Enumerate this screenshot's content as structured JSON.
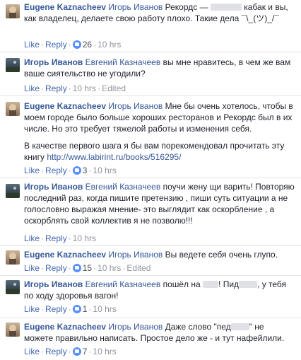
{
  "comments": [
    {
      "author": "Eugene Kaznacheev",
      "mention": "Игорь Иванов",
      "text_a": "Рекордс —",
      "text_b": "кабак и вы, как владелец, делаете свою работу плохо. Такие дела ¯\\_(ツ)_/¯",
      "like": "Like",
      "reply": "Reply",
      "likes": "26",
      "time": "10 hrs",
      "edited": ""
    },
    {
      "author": "Игорь Иванов",
      "mention": "Евгений Казначеев",
      "text": "вы мне нравитесь, в чем же вам ваше сиятельство не угодили?",
      "like": "Like",
      "reply": "Reply",
      "likes": "",
      "time": "10 hrs",
      "edited": "Edited"
    },
    {
      "author": "Eugene Kaznacheev",
      "mention": "Игорь Иванов",
      "text": "Мне бы очень хотелось, чтобы в моем городе было больше хороших ресторанов и Рекордс был в их числе. Но это требует тяжелой работы и изменения себя.",
      "text2": "В качестве первого шага я бы вам порекомендовал прочитать эту книгу",
      "link": "http://www.labirint.ru/books/516295/",
      "like": "Like",
      "reply": "Reply",
      "likes": "3",
      "time": "10 hrs",
      "edited": ""
    },
    {
      "author": "Игорь Иванов",
      "mention": "Евгений Казначеев",
      "text": "поучи жену щи варить! Повторяю последний раз, когда пишите претензию , пиши суть ситуации а не голословно выражая мнение- это выглядит как оскорбление , а оскорблять свой коллектив я не позволю!!!",
      "like": "Like",
      "reply": "Reply",
      "likes": "",
      "time": "10 hrs",
      "edited": ""
    },
    {
      "author": "Eugene Kaznacheev",
      "mention": "Игорь Иванов",
      "text": "Вы ведете себя очень глупо.",
      "like": "Like",
      "reply": "Reply",
      "likes": "15",
      "time": "10 hrs",
      "edited": "Edited"
    },
    {
      "author": "Игорь Иванов",
      "mention": "Евгений Казначеев",
      "text_a": "пошёл на",
      "text_b": "! Пид",
      "text_c": ", у тебя по ходу здоровья вагон!",
      "like": "Like",
      "reply": "Reply",
      "likes": "1",
      "time": "10 hrs",
      "edited": ""
    },
    {
      "author": "Eugene Kaznacheev",
      "mention": "Игорь Иванов",
      "text_a": "Даже слово \"пед",
      "text_b": "\" не можете правильно написать. Простое дело же - и тут нафейлили.",
      "like": "Like",
      "reply": "Reply",
      "likes": "7",
      "time": "10 hrs",
      "edited": ""
    }
  ],
  "colors": {
    "link": "#365899",
    "action": "#4267b2",
    "meta": "#90949c",
    "like_badge": "#5890ff"
  }
}
